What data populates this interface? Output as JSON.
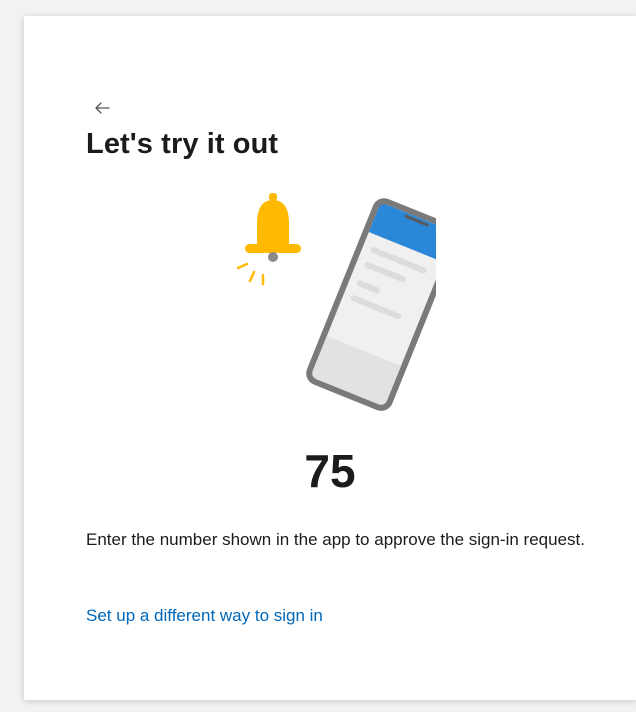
{
  "page": {
    "title": "Let's try it out",
    "number": "75",
    "description": "Enter the number shown in the app to approve the sign-in request.",
    "alt_link": "Set up a different way to sign in"
  },
  "icons": {
    "back": "arrow-left-icon",
    "illustration": "phone-with-notification-bell-illustration"
  },
  "colors": {
    "link": "#0067b8",
    "bell": "#ffb900",
    "phone_header": "#2b88d8"
  }
}
